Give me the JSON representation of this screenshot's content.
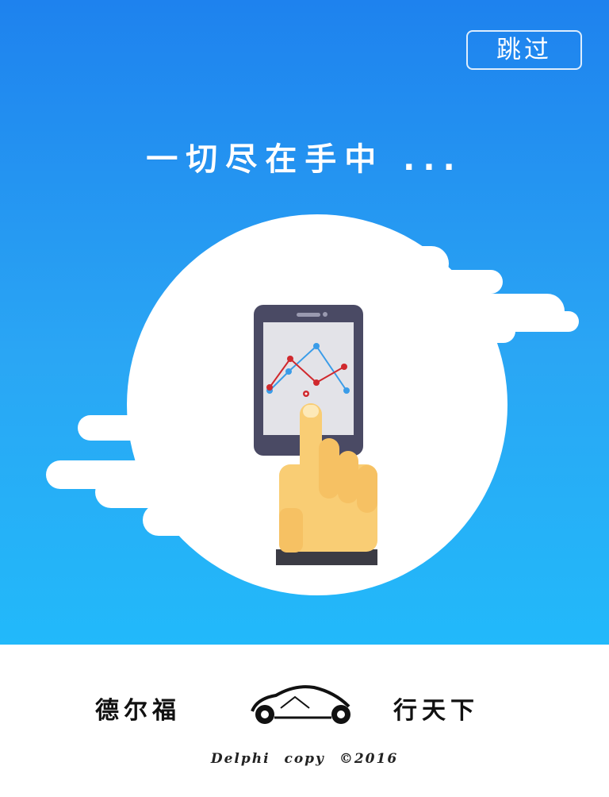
{
  "splash": {
    "skip_label": "跳过",
    "headline": "一切尽在手中 ..."
  },
  "footer": {
    "brand_left": "德尔福",
    "brand_right": "行天下",
    "copyright": "Delphi  copy  ©2016"
  },
  "colors": {
    "gradient_top": "#1e82ee",
    "gradient_bottom": "#22b9fa",
    "cloud": "#ffffff",
    "phone_body": "#4a4a64",
    "hand": "#f9cd74",
    "chart_red": "#d0292e",
    "chart_blue": "#3a9ce8"
  },
  "icons": {
    "car_logo": "car-logo-icon",
    "phone": "smartphone-icon",
    "hand": "pointing-hand-icon"
  }
}
